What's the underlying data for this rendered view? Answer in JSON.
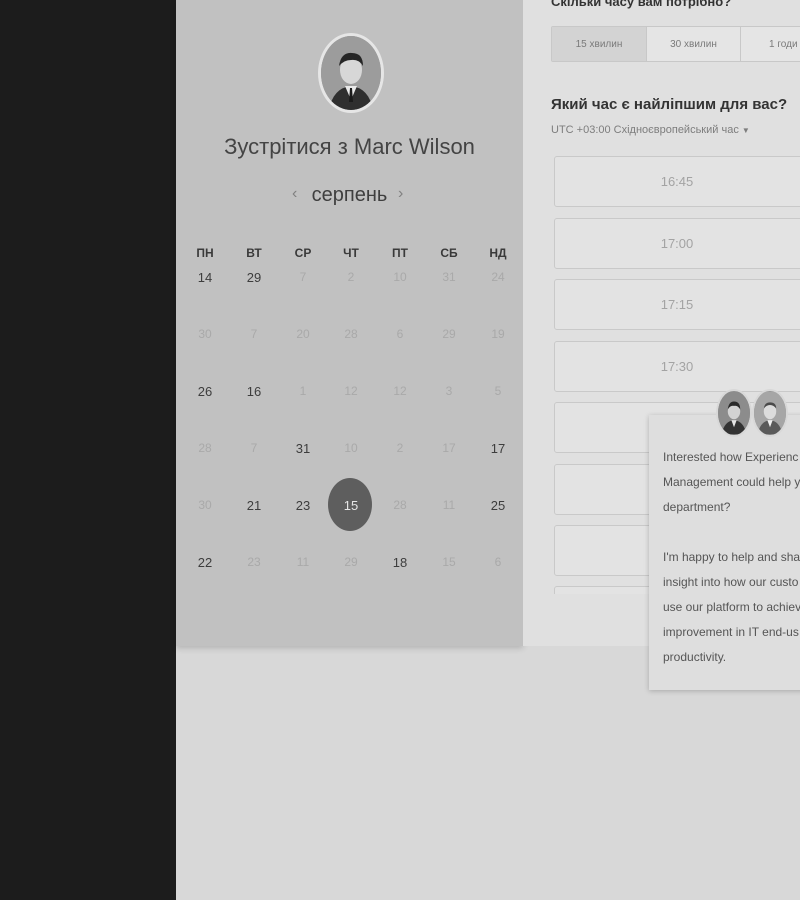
{
  "calendar": {
    "meet_title": "Зустрітися з Marc Wilson",
    "month": "серпень",
    "prev": "‹",
    "next": "›",
    "weekdays": [
      "ПН",
      "ВТ",
      "СР",
      "ЧТ",
      "ПТ",
      "СБ",
      "НД"
    ],
    "weeks": [
      [
        {
          "d": "14",
          "a": true
        },
        {
          "d": "29",
          "a": true
        },
        {
          "d": "7",
          "a": false
        },
        {
          "d": "2",
          "a": false
        },
        {
          "d": "10",
          "a": false
        },
        {
          "d": "31",
          "a": false
        },
        {
          "d": "24",
          "a": false
        }
      ],
      [
        {
          "d": "30",
          "a": false
        },
        {
          "d": "7",
          "a": false
        },
        {
          "d": "20",
          "a": false
        },
        {
          "d": "28",
          "a": false
        },
        {
          "d": "6",
          "a": false
        },
        {
          "d": "29",
          "a": false
        },
        {
          "d": "19",
          "a": false
        }
      ],
      [
        {
          "d": "26",
          "a": true
        },
        {
          "d": "16",
          "a": true
        },
        {
          "d": "1",
          "a": false
        },
        {
          "d": "12",
          "a": false
        },
        {
          "d": "12",
          "a": false
        },
        {
          "d": "3",
          "a": false
        },
        {
          "d": "5",
          "a": false
        }
      ],
      [
        {
          "d": "28",
          "a": false
        },
        {
          "d": "7",
          "a": false
        },
        {
          "d": "31",
          "a": true
        },
        {
          "d": "10",
          "a": false
        },
        {
          "d": "2",
          "a": false
        },
        {
          "d": "17",
          "a": false
        },
        {
          "d": "17",
          "a": true
        }
      ],
      [
        {
          "d": "30",
          "a": false
        },
        {
          "d": "21",
          "a": true
        },
        {
          "d": "23",
          "a": true
        },
        {
          "d": "15",
          "a": true,
          "sel": true
        },
        {
          "d": "28",
          "a": false
        },
        {
          "d": "11",
          "a": false
        },
        {
          "d": "25",
          "a": true
        }
      ],
      [
        {
          "d": "22",
          "a": true
        },
        {
          "d": "23",
          "a": false
        },
        {
          "d": "11",
          "a": false
        },
        {
          "d": "29",
          "a": false
        },
        {
          "d": "18",
          "a": true
        },
        {
          "d": "15",
          "a": false
        },
        {
          "d": "6",
          "a": false
        }
      ]
    ]
  },
  "scheduler": {
    "duration_question": "Скільки часу вам потрібно?",
    "durations": [
      "15 хвилин",
      "30 хвилин",
      "1 годи"
    ],
    "selected_duration": "15 хвилин",
    "time_question": "Який час є найліпшим для вас?",
    "timezone": "UTC +03:00 Східноєвропейський час",
    "slots": [
      "16:45",
      "17:00",
      "17:15",
      "17:30",
      "",
      "",
      "",
      ""
    ]
  },
  "chat": {
    "paragraph1": "Interested how Experienc\nManagement could help y\ndepartment?",
    "paragraph2": "I'm happy to help and sha\ninsight into how our custo\nuse our platform to achiev\nimprovement in IT end-us\nproductivity."
  }
}
